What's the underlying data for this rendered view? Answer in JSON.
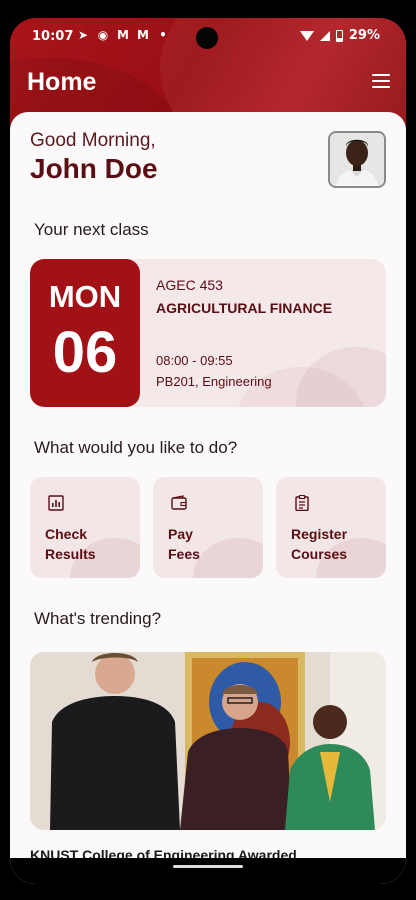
{
  "status_bar": {
    "time": "10:07",
    "notification_icons": [
      "telegram-icon",
      "messenger-icon",
      "gmail-icon",
      "gmail-icon",
      "dot-icon"
    ],
    "battery_percent": "29%"
  },
  "header": {
    "title": "Home"
  },
  "greeting": {
    "text": "Good Morning,",
    "name": "John Doe"
  },
  "next_class": {
    "section_title": "Your next class",
    "day": "MON",
    "date": "06",
    "course_code": "AGEC 453",
    "course_name": "AGRICULTURAL FINANCE",
    "time": "08:00 - 09:55",
    "location": "PB201, Engineering"
  },
  "actions": {
    "section_title": "What would you like to do?",
    "items": [
      {
        "line1": "Check",
        "line2": "Results",
        "icon": "bar-chart-icon"
      },
      {
        "line1": "Pay",
        "line2": "Fees",
        "icon": "wallet-icon"
      },
      {
        "line1": "Register",
        "line2": "Courses",
        "icon": "clipboard-icon"
      }
    ]
  },
  "trending": {
    "section_title": "What's trending?",
    "news_title": "KNUST College of Engineering Awarded"
  },
  "colors": {
    "primary": "#a21116",
    "dark_text": "#5a0d12",
    "card_bg": "#f5e8e9",
    "sheet_bg": "#fbf9f9"
  }
}
